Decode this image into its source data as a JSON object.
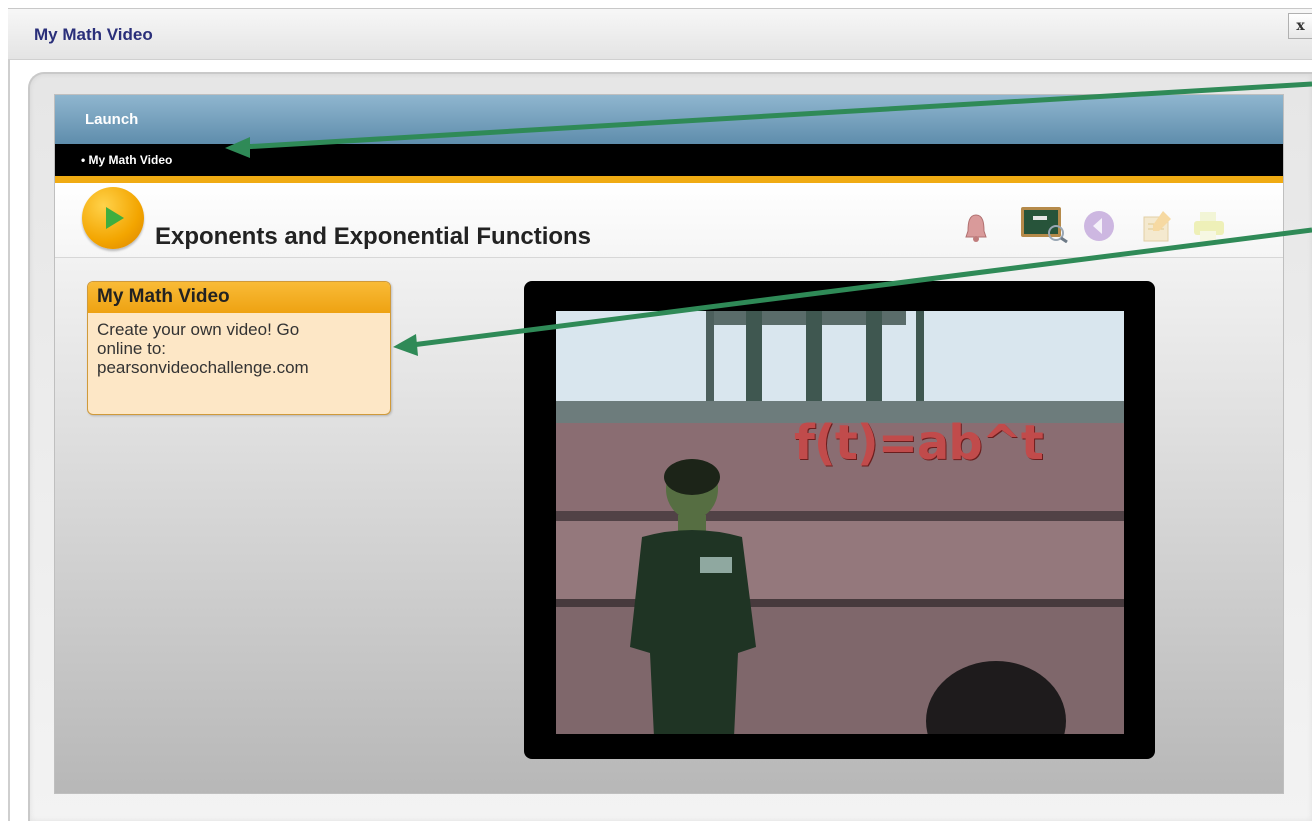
{
  "window": {
    "title": "My Math Video",
    "close_label": "x"
  },
  "panel": {
    "launch_label": "Launch",
    "breadcrumb": "• My Math Video",
    "lesson_title": "Exponents and Exponential Functions"
  },
  "tools": [
    {
      "icon": "bell-icon"
    },
    {
      "icon": "chalkboard-icon"
    },
    {
      "icon": "audio-icon"
    },
    {
      "icon": "notes-icon"
    },
    {
      "icon": "print-icon"
    }
  ],
  "callout": {
    "heading": "My Math Video",
    "body_lines": [
      "Create your own video! Go",
      "online to:",
      "pearsonvideochallenge.com"
    ]
  },
  "video": {
    "overlay_text": "f(t)=ab^t"
  },
  "colors": {
    "accent_gold": "#f0ab13",
    "launch_blue": "#6f9bb8",
    "arrow_green": "#2f8a57"
  }
}
